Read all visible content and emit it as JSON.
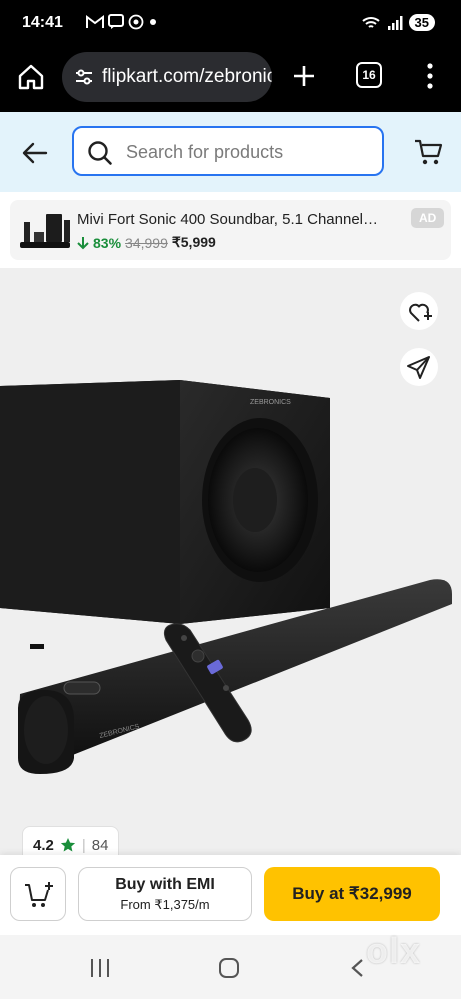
{
  "status_bar": {
    "time": "14:41",
    "battery": "35",
    "left_icons": [
      "gmail-icon",
      "messages-icon",
      "whatsapp-icon",
      "dot-icon"
    ],
    "right_icons": [
      "wifi-icon",
      "signal-icon",
      "battery-icon"
    ]
  },
  "browser": {
    "url": "flipkart.com/zebronics",
    "tab_count": "16"
  },
  "header": {
    "search_placeholder": "Search for products"
  },
  "ad": {
    "title": "Mivi Fort Sonic 400 Soundbar, 5.1 Channel…",
    "discount": "83%",
    "mrp": "34,999",
    "price": "₹5,999",
    "badge": "AD"
  },
  "product": {
    "rating": "4.2",
    "rating_count": "84",
    "brand_on_image": "ZEBRONICS"
  },
  "actions": {
    "emi_title": "Buy with EMI",
    "emi_sub": "From ₹1,375/m",
    "buy_label": "Buy at ₹32,999"
  },
  "watermark": "olx",
  "colors": {
    "primary_blue": "#2874f0",
    "header_bg": "#e3f3fb",
    "buy_yellow": "#ffc200",
    "discount_green": "#1a8e3b",
    "star_green": "#1a8e3b"
  }
}
